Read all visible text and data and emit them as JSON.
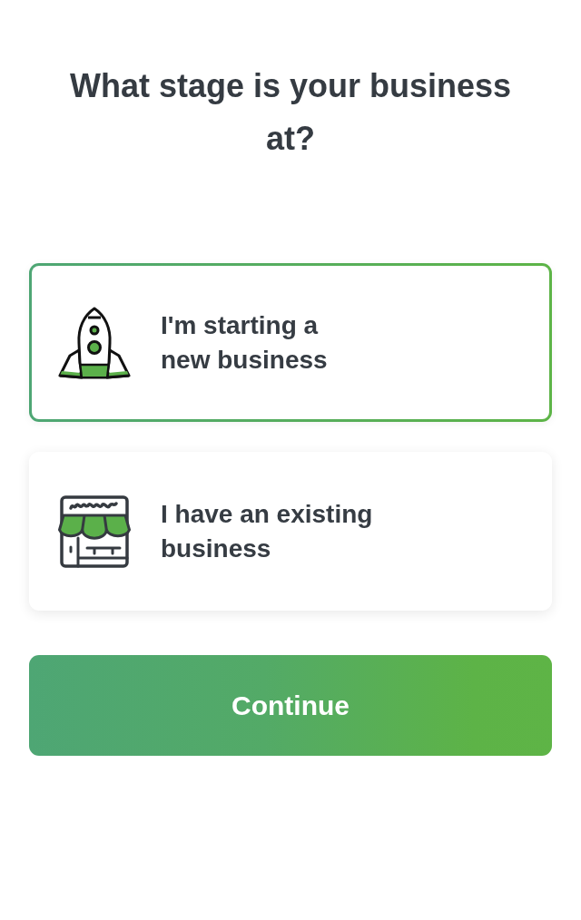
{
  "title": "What stage is your business at?",
  "options": [
    {
      "kind": "rocket",
      "lines": [
        "I'm starting a",
        "new business"
      ],
      "selected": true
    },
    {
      "kind": "shop",
      "lines": [
        "I have an existing",
        "business"
      ],
      "selected": false
    }
  ],
  "continue_button": {
    "label": "Continue"
  }
}
